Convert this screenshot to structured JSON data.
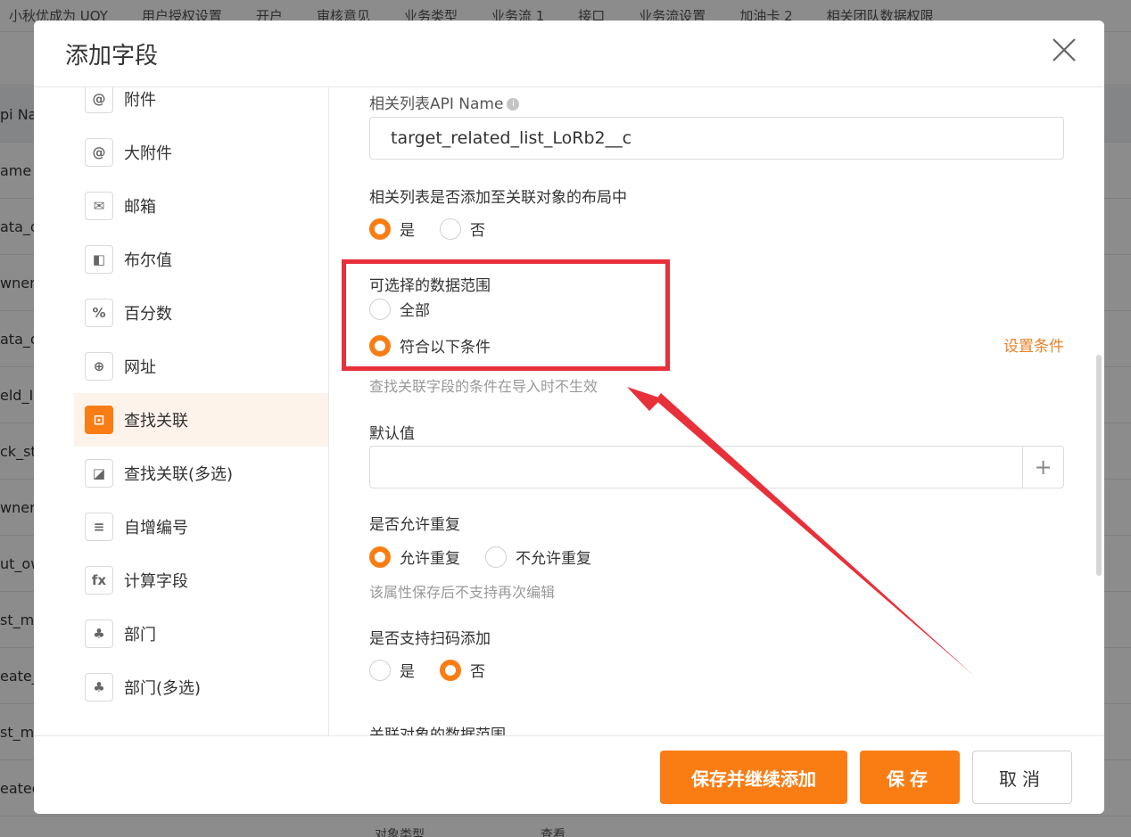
{
  "background": {
    "nav_items": [
      "小秋优成为 UOY",
      "用户授权设置",
      "开户",
      "审核意见",
      "业务类型",
      "业务流 1",
      "接口",
      "业务流设置",
      "加油卡 2",
      "相关团队数据权限"
    ],
    "rows": [
      "pi Na",
      "ame",
      "ata_o",
      "wner",
      "ata_o",
      "eld_In",
      "ck_st",
      "wner_",
      "ut_ow",
      "st_m",
      "eate_",
      "st_m",
      "eated"
    ],
    "footer_texts": [
      "对象类型",
      "查看"
    ]
  },
  "modal": {
    "title": "添加字段",
    "close_icon": "close-icon"
  },
  "sidebar": {
    "items": [
      {
        "label": "附件",
        "icon": "attachment-icon",
        "glyph": "@"
      },
      {
        "label": "大附件",
        "icon": "large-attachment-icon",
        "glyph": "@"
      },
      {
        "label": "邮箱",
        "icon": "email-icon",
        "glyph": "✉"
      },
      {
        "label": "布尔值",
        "icon": "boolean-icon",
        "glyph": "◧"
      },
      {
        "label": "百分数",
        "icon": "percent-icon",
        "glyph": "%"
      },
      {
        "label": "网址",
        "icon": "globe-icon",
        "glyph": "⊕"
      },
      {
        "label": "查找关联",
        "icon": "lookup-icon",
        "glyph": "⊡",
        "active": true
      },
      {
        "label": "查找关联(多选)",
        "icon": "lookup-multi-icon",
        "glyph": "◪"
      },
      {
        "label": "自增编号",
        "icon": "auto-number-icon",
        "glyph": "≡"
      },
      {
        "label": "计算字段",
        "icon": "formula-icon",
        "glyph": "fx"
      },
      {
        "label": "部门",
        "icon": "department-icon",
        "glyph": "♣"
      },
      {
        "label": "部门(多选)",
        "icon": "department-multi-icon",
        "glyph": "♣"
      }
    ]
  },
  "form": {
    "api_name_label": "相关列表API Name",
    "api_name_value": "target_related_list_LoRb2__c",
    "add_to_layout_label": "相关列表是否添加至关联对象的布局中",
    "add_to_layout_options": [
      "是",
      "否"
    ],
    "add_to_layout_selected": "是",
    "data_range_label": "可选择的数据范围",
    "data_range_options": [
      "全部",
      "符合以下条件"
    ],
    "data_range_selected": "符合以下条件",
    "set_condition_link": "设置条件",
    "data_range_hint": "查找关联字段的条件在导入时不生效",
    "default_value_label": "默认值",
    "default_value": "",
    "default_plus": "+",
    "allow_duplicate_label": "是否允许重复",
    "allow_duplicate_options": [
      "允许重复",
      "不允许重复"
    ],
    "allow_duplicate_selected": "允许重复",
    "allow_duplicate_hint": "该属性保存后不支持再次编辑",
    "scan_add_label": "是否支持扫码添加",
    "scan_add_options": [
      "是",
      "否"
    ],
    "scan_add_selected": "否",
    "related_scope_label": "关联对象的数据范围"
  },
  "footer": {
    "save_continue_label": "保存并继续添加",
    "save_label": "保存",
    "cancel_label": "取消"
  },
  "colors": {
    "accent": "#fa7d14",
    "annotation": "#e8303a",
    "link": "#e8822a"
  }
}
